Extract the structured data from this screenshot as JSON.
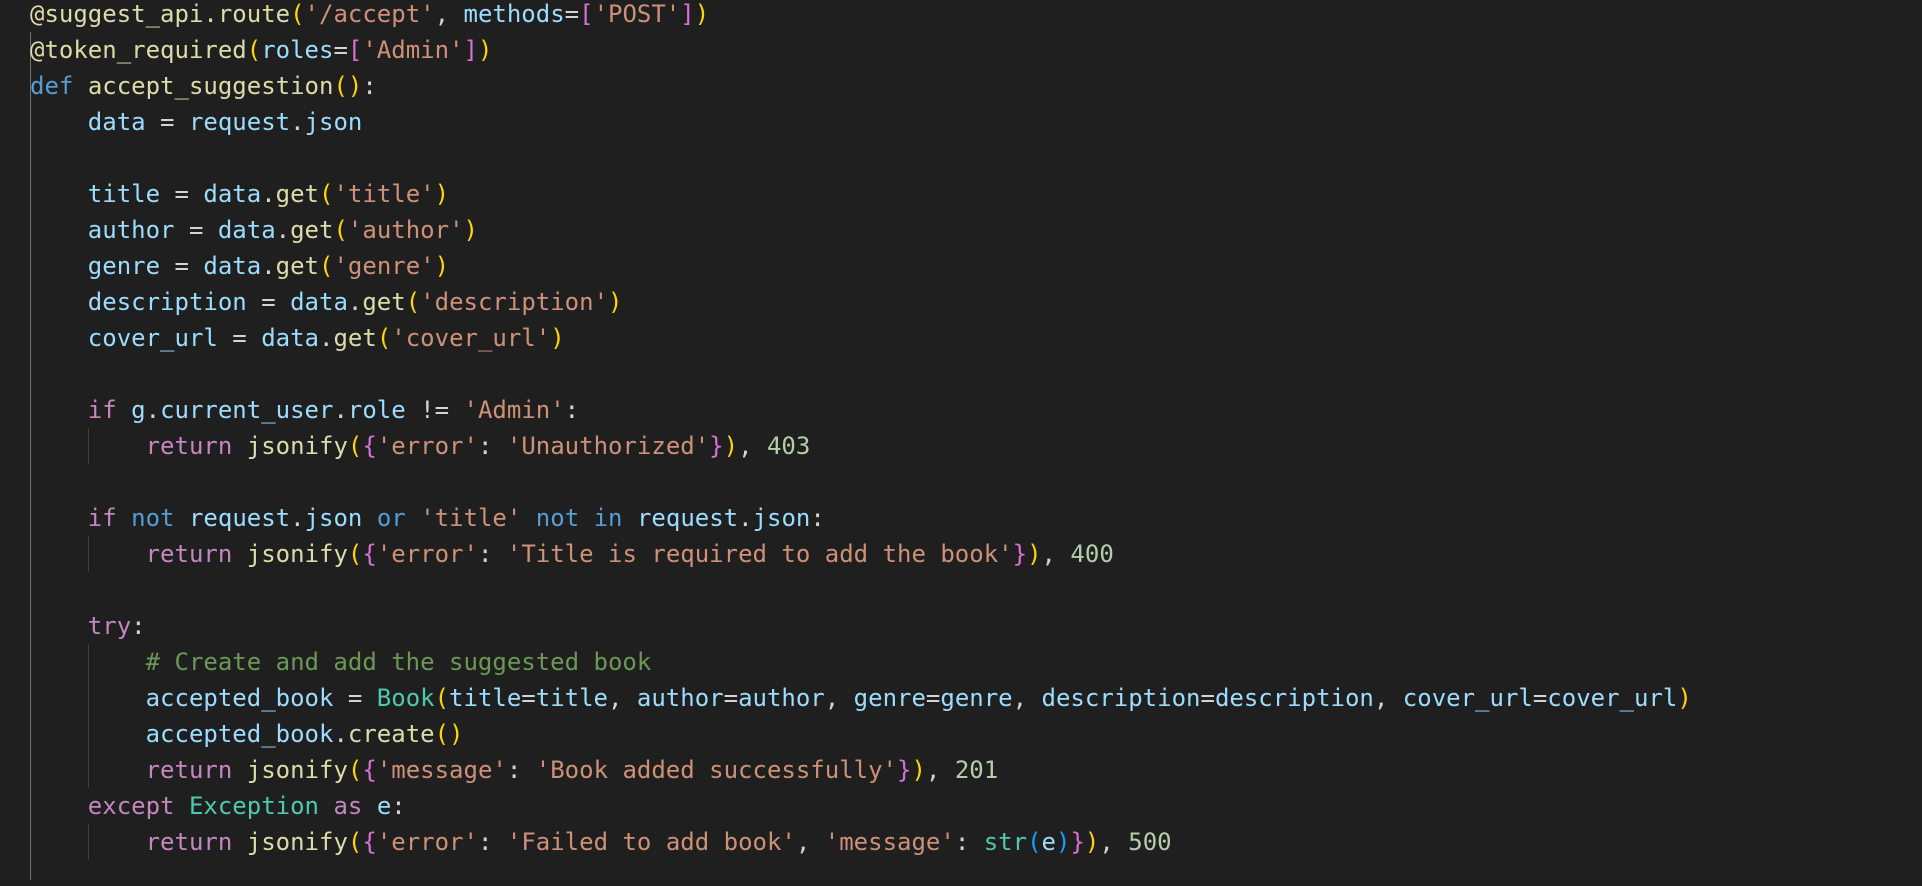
{
  "colors": {
    "background": "#1f1f1f",
    "default_text": "#d4d4d4",
    "decorator": "#dcdcaa",
    "function": "#dcdcaa",
    "variable": "#9cdcfe",
    "string": "#ce9178",
    "number": "#b5cea8",
    "control_keyword": "#c586c0",
    "keyword": "#569cd6",
    "class": "#4ec9b0",
    "comment": "#6a9955",
    "bracket_level_1": "#ffd700",
    "bracket_level_2": "#da70d6",
    "bracket_level_3": "#179fff"
  },
  "code": {
    "language": "python",
    "lines": [
      [
        [
          "decorator",
          "@suggest_api.route"
        ],
        [
          "b1",
          "("
        ],
        [
          "str",
          "'/accept'"
        ],
        [
          "p",
          ", "
        ],
        [
          "param",
          "methods"
        ],
        [
          "p",
          "="
        ],
        [
          "b2",
          "["
        ],
        [
          "str",
          "'POST'"
        ],
        [
          "b2",
          "]"
        ],
        [
          "b1",
          ")"
        ]
      ],
      [
        [
          "decorator",
          "@token_required"
        ],
        [
          "b1",
          "("
        ],
        [
          "param",
          "roles"
        ],
        [
          "p",
          "="
        ],
        [
          "b2",
          "["
        ],
        [
          "str",
          "'Admin'"
        ],
        [
          "b2",
          "]"
        ],
        [
          "b1",
          ")"
        ]
      ],
      [
        [
          "kw",
          "def"
        ],
        [
          "p",
          " "
        ],
        [
          "fn",
          "accept_suggestion"
        ],
        [
          "b1",
          "()"
        ],
        [
          "p",
          ":"
        ]
      ],
      [
        [
          "p",
          "    "
        ],
        [
          "var",
          "data"
        ],
        [
          "p",
          " = "
        ],
        [
          "var",
          "request"
        ],
        [
          "p",
          "."
        ],
        [
          "var",
          "json"
        ]
      ],
      [],
      [
        [
          "p",
          "    "
        ],
        [
          "var",
          "title"
        ],
        [
          "p",
          " = "
        ],
        [
          "var",
          "data"
        ],
        [
          "p",
          "."
        ],
        [
          "fn",
          "get"
        ],
        [
          "b1",
          "("
        ],
        [
          "str",
          "'title'"
        ],
        [
          "b1",
          ")"
        ]
      ],
      [
        [
          "p",
          "    "
        ],
        [
          "var",
          "author"
        ],
        [
          "p",
          " = "
        ],
        [
          "var",
          "data"
        ],
        [
          "p",
          "."
        ],
        [
          "fn",
          "get"
        ],
        [
          "b1",
          "("
        ],
        [
          "str",
          "'author'"
        ],
        [
          "b1",
          ")"
        ]
      ],
      [
        [
          "p",
          "    "
        ],
        [
          "var",
          "genre"
        ],
        [
          "p",
          " = "
        ],
        [
          "var",
          "data"
        ],
        [
          "p",
          "."
        ],
        [
          "fn",
          "get"
        ],
        [
          "b1",
          "("
        ],
        [
          "str",
          "'genre'"
        ],
        [
          "b1",
          ")"
        ]
      ],
      [
        [
          "p",
          "    "
        ],
        [
          "var",
          "description"
        ],
        [
          "p",
          " = "
        ],
        [
          "var",
          "data"
        ],
        [
          "p",
          "."
        ],
        [
          "fn",
          "get"
        ],
        [
          "b1",
          "("
        ],
        [
          "str",
          "'description'"
        ],
        [
          "b1",
          ")"
        ]
      ],
      [
        [
          "p",
          "    "
        ],
        [
          "var",
          "cover_url"
        ],
        [
          "p",
          " = "
        ],
        [
          "var",
          "data"
        ],
        [
          "p",
          "."
        ],
        [
          "fn",
          "get"
        ],
        [
          "b1",
          "("
        ],
        [
          "str",
          "'cover_url'"
        ],
        [
          "b1",
          ")"
        ]
      ],
      [],
      [
        [
          "p",
          "    "
        ],
        [
          "ctl",
          "if"
        ],
        [
          "p",
          " "
        ],
        [
          "var",
          "g"
        ],
        [
          "p",
          "."
        ],
        [
          "var",
          "current_user"
        ],
        [
          "p",
          "."
        ],
        [
          "var",
          "role"
        ],
        [
          "p",
          " != "
        ],
        [
          "str",
          "'Admin'"
        ],
        [
          "p",
          ":"
        ]
      ],
      [
        [
          "p",
          "        "
        ],
        [
          "ctl",
          "return"
        ],
        [
          "p",
          " "
        ],
        [
          "fn",
          "jsonify"
        ],
        [
          "b1",
          "("
        ],
        [
          "b2",
          "{"
        ],
        [
          "str",
          "'error'"
        ],
        [
          "p",
          ": "
        ],
        [
          "str",
          "'Unauthorized'"
        ],
        [
          "b2",
          "}"
        ],
        [
          "b1",
          ")"
        ],
        [
          "p",
          ", "
        ],
        [
          "num",
          "403"
        ]
      ],
      [],
      [
        [
          "p",
          "    "
        ],
        [
          "ctl",
          "if"
        ],
        [
          "p",
          " "
        ],
        [
          "kw",
          "not"
        ],
        [
          "p",
          " "
        ],
        [
          "var",
          "request"
        ],
        [
          "p",
          "."
        ],
        [
          "var",
          "json"
        ],
        [
          "p",
          " "
        ],
        [
          "kw",
          "or"
        ],
        [
          "p",
          " "
        ],
        [
          "str",
          "'title'"
        ],
        [
          "p",
          " "
        ],
        [
          "kw",
          "not"
        ],
        [
          "p",
          " "
        ],
        [
          "kw",
          "in"
        ],
        [
          "p",
          " "
        ],
        [
          "var",
          "request"
        ],
        [
          "p",
          "."
        ],
        [
          "var",
          "json"
        ],
        [
          "p",
          ":"
        ]
      ],
      [
        [
          "p",
          "        "
        ],
        [
          "ctl",
          "return"
        ],
        [
          "p",
          " "
        ],
        [
          "fn",
          "jsonify"
        ],
        [
          "b1",
          "("
        ],
        [
          "b2",
          "{"
        ],
        [
          "str",
          "'error'"
        ],
        [
          "p",
          ": "
        ],
        [
          "str",
          "'Title is required to add the book'"
        ],
        [
          "b2",
          "}"
        ],
        [
          "b1",
          ")"
        ],
        [
          "p",
          ", "
        ],
        [
          "num",
          "400"
        ]
      ],
      [],
      [
        [
          "p",
          "    "
        ],
        [
          "ctl",
          "try"
        ],
        [
          "p",
          ":"
        ]
      ],
      [
        [
          "p",
          "        "
        ],
        [
          "cmt",
          "# Create and add the suggested book"
        ]
      ],
      [
        [
          "p",
          "        "
        ],
        [
          "var",
          "accepted_book"
        ],
        [
          "p",
          " = "
        ],
        [
          "cls",
          "Book"
        ],
        [
          "b1",
          "("
        ],
        [
          "param",
          "title"
        ],
        [
          "p",
          "="
        ],
        [
          "var",
          "title"
        ],
        [
          "p",
          ", "
        ],
        [
          "param",
          "author"
        ],
        [
          "p",
          "="
        ],
        [
          "var",
          "author"
        ],
        [
          "p",
          ", "
        ],
        [
          "param",
          "genre"
        ],
        [
          "p",
          "="
        ],
        [
          "var",
          "genre"
        ],
        [
          "p",
          ", "
        ],
        [
          "param",
          "description"
        ],
        [
          "p",
          "="
        ],
        [
          "var",
          "description"
        ],
        [
          "p",
          ", "
        ],
        [
          "param",
          "cover_url"
        ],
        [
          "p",
          "="
        ],
        [
          "var",
          "cover_url"
        ],
        [
          "b1",
          ")"
        ]
      ],
      [
        [
          "p",
          "        "
        ],
        [
          "var",
          "accepted_book"
        ],
        [
          "p",
          "."
        ],
        [
          "fn",
          "create"
        ],
        [
          "b1",
          "()"
        ]
      ],
      [
        [
          "p",
          "        "
        ],
        [
          "ctl",
          "return"
        ],
        [
          "p",
          " "
        ],
        [
          "fn",
          "jsonify"
        ],
        [
          "b1",
          "("
        ],
        [
          "b2",
          "{"
        ],
        [
          "str",
          "'message'"
        ],
        [
          "p",
          ": "
        ],
        [
          "str",
          "'Book added successfully'"
        ],
        [
          "b2",
          "}"
        ],
        [
          "b1",
          ")"
        ],
        [
          "p",
          ", "
        ],
        [
          "num",
          "201"
        ]
      ],
      [
        [
          "p",
          "    "
        ],
        [
          "ctl",
          "except"
        ],
        [
          "p",
          " "
        ],
        [
          "cls",
          "Exception"
        ],
        [
          "p",
          " "
        ],
        [
          "ctl",
          "as"
        ],
        [
          "p",
          " "
        ],
        [
          "var",
          "e"
        ],
        [
          "p",
          ":"
        ]
      ],
      [
        [
          "p",
          "        "
        ],
        [
          "ctl",
          "return"
        ],
        [
          "p",
          " "
        ],
        [
          "fn",
          "jsonify"
        ],
        [
          "b1",
          "("
        ],
        [
          "b2",
          "{"
        ],
        [
          "str",
          "'error'"
        ],
        [
          "p",
          ": "
        ],
        [
          "str",
          "'Failed to add book'"
        ],
        [
          "p",
          ", "
        ],
        [
          "str",
          "'message'"
        ],
        [
          "p",
          ": "
        ],
        [
          "cls",
          "str"
        ],
        [
          "b3",
          "("
        ],
        [
          "var",
          "e"
        ],
        [
          "b3",
          ")"
        ],
        [
          "b2",
          "}"
        ],
        [
          "b1",
          ")"
        ],
        [
          "p",
          ", "
        ],
        [
          "num",
          "500"
        ]
      ]
    ]
  }
}
